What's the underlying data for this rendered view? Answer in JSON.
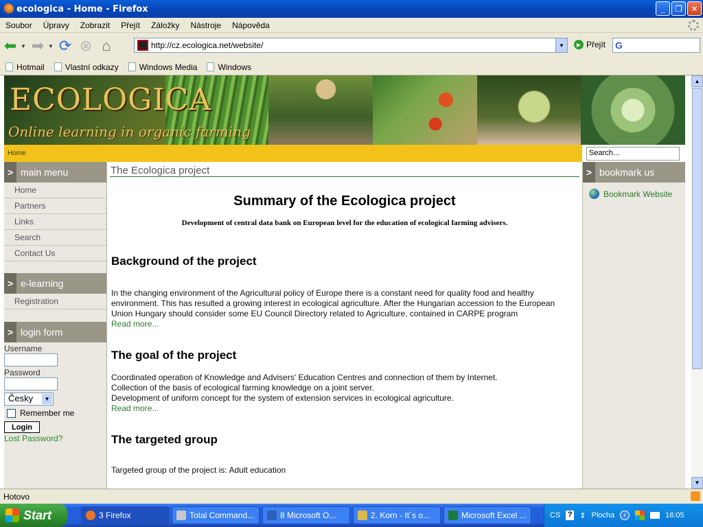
{
  "window": {
    "title": "ecologica - Home - Firefox",
    "buttons": [
      "_",
      "❐",
      "✕"
    ]
  },
  "menu": [
    "Soubor",
    "Úpravy",
    "Zobrazit",
    "Přejít",
    "Záložky",
    "Nástroje",
    "Nápověda"
  ],
  "nav": {
    "url": "http://cz.ecologica.net/website/",
    "go_label": "Přejít"
  },
  "bookmarks": [
    "Hotmail",
    "Vlastní odkazy",
    "Windows Media",
    "Windows"
  ],
  "banner": {
    "logo": "ECOLOGICA",
    "tagline": "Online learning in organic farming"
  },
  "breadcrumb": "Home",
  "site_search_value": "Search...",
  "left": {
    "main_menu_title": "main menu",
    "main_menu": [
      "Home",
      "Partners",
      "Links",
      "Search",
      "Contact Us"
    ],
    "elearning_title": "e-learning",
    "elearning": [
      "Registration"
    ],
    "login_title": "login form",
    "username_label": "Username",
    "password_label": "Password",
    "language": "Česky",
    "remember_label": "Remember me",
    "login_button": "Login",
    "lost_password": "Lost Password?"
  },
  "main": {
    "page_title": "The Ecologica project",
    "heading": "Summary of the Ecologica project",
    "subheading": "Development of central data bank on European level for the education of ecological farming advisers.",
    "sections": [
      {
        "title": "Background of the project",
        "lines": [
          "In the changing environment of the Agricultural policy of Europe there is a constant need for quality food and healthy",
          "environment. This has resulted a growing interest in ecological agriculture. After the Hungarian accession to the European",
          "Union Hungary should consider some EU Council Directory related to Agriculture, contained in CARPE program"
        ],
        "read_more": "Read more..."
      },
      {
        "title": "The goal of the project",
        "lines": [
          "Coordinated operation of Knowledge and Advisers' Education Centres and connection of them by Internet.",
          "Collection of the basis of ecological farming knowledge on a joint server.",
          "Development of uniform concept for the system of extension services in ecological agriculture."
        ],
        "read_more": "Read more..."
      },
      {
        "title": "The targeted group",
        "lines": [
          "Targeted group of the project is: Adult education"
        ]
      }
    ]
  },
  "right": {
    "title": "bookmark us",
    "link": "Bookmark Website"
  },
  "status": "Hotovo",
  "taskbar": {
    "start": "Start",
    "tasks": [
      "3 Firefox",
      "Total Command...",
      "8 Microsoft O...",
      "2. Korn - It´s o...",
      "Microsoft Excel ..."
    ],
    "lang": "CS",
    "desktop": "Plocha",
    "time": "16:05"
  }
}
